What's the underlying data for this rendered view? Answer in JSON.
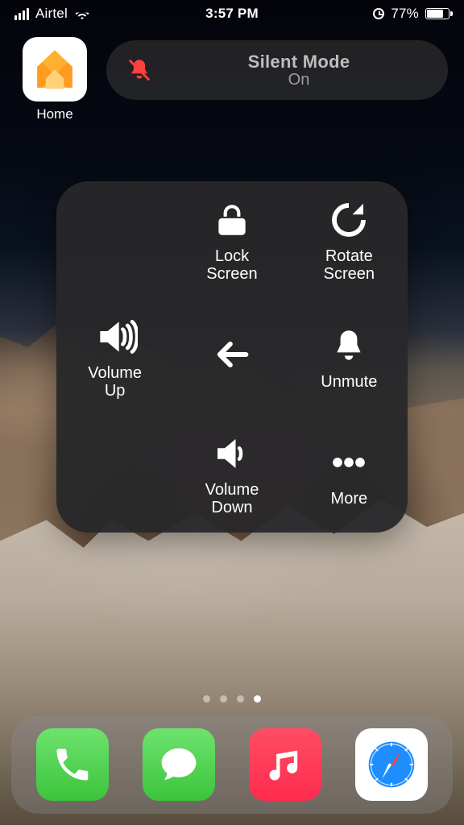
{
  "status": {
    "carrier": "Airtel",
    "time": "3:57 PM",
    "battery_pct": "77%",
    "battery_fill": 77
  },
  "apps": {
    "home_label": "Home"
  },
  "banner": {
    "title": "Silent Mode",
    "state": "On"
  },
  "panel": {
    "lock": "Lock\nScreen",
    "rotate": "Rotate\nScreen",
    "vol_up": "Volume\nUp",
    "back": "",
    "unmute": "Unmute",
    "vol_down": "Volume\nDown",
    "more": "More"
  },
  "pager": {
    "count": 4,
    "active": 4
  }
}
